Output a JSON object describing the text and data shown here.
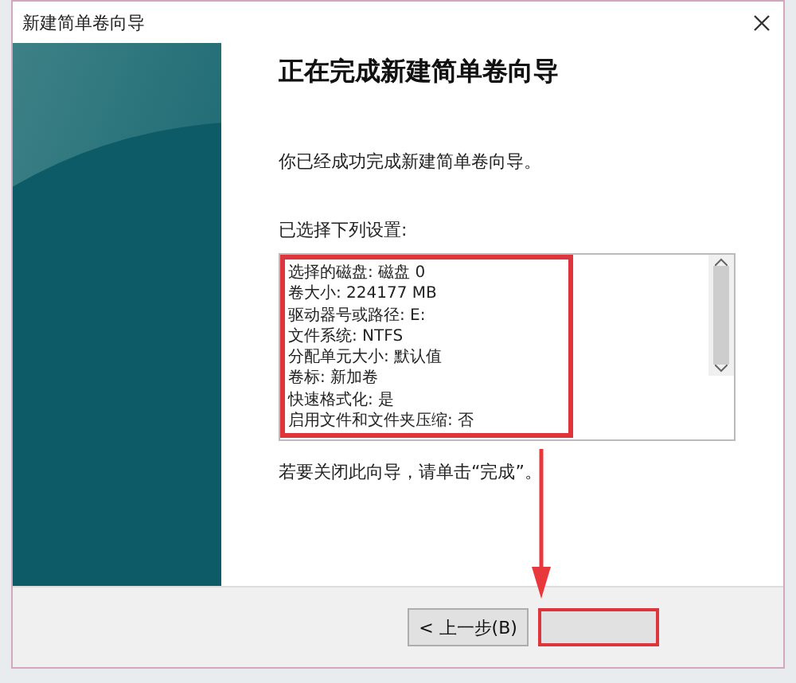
{
  "window": {
    "title": "新建简单卷向导"
  },
  "heading": "正在完成新建简单卷向导",
  "intro": "你已经成功完成新建简单卷向导。",
  "settings": {
    "label": "已选择下列设置:",
    "lines": [
      "选择的磁盘: 磁盘 0",
      "卷大小: 224177 MB",
      "驱动器号或路径: E:",
      "文件系统: NTFS",
      "分配单元大小: 默认值",
      "卷标: 新加卷",
      "快速格式化: 是",
      "启用文件和文件夹压缩: 否"
    ]
  },
  "close_hint": "若要关闭此向导，请单击“完成”。",
  "buttons": [
    {
      "label": "< 上一步(B)",
      "kind": "normal"
    },
    {
      "kind": "highlighted"
    }
  ]
}
